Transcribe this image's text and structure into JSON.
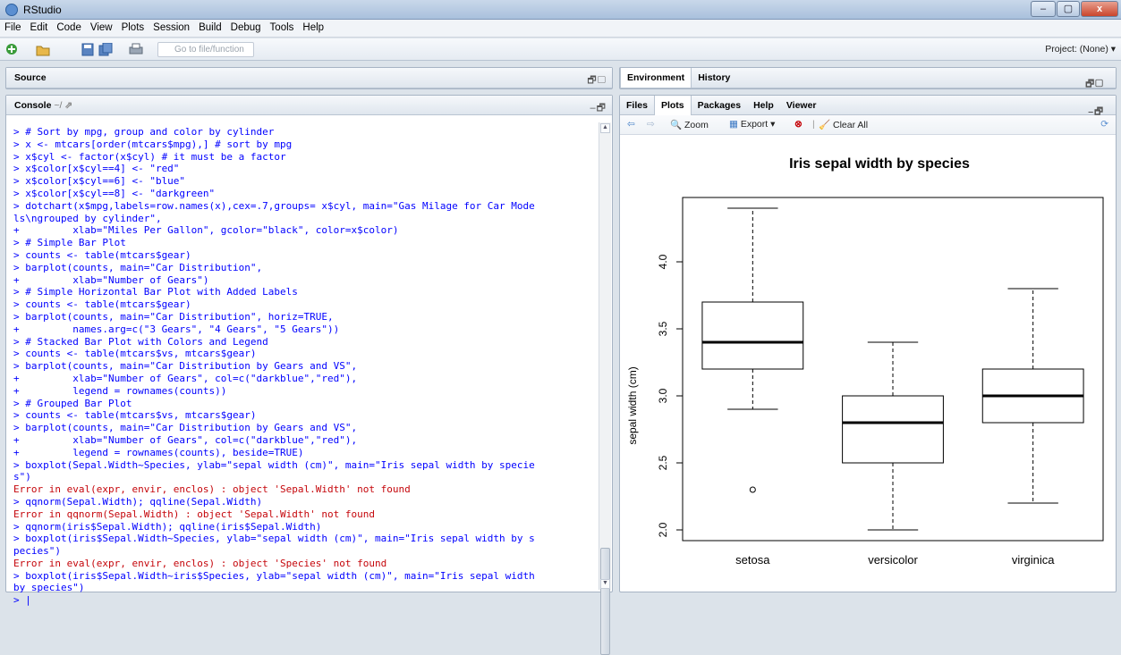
{
  "window": {
    "title": "RStudio",
    "controls": [
      "–",
      "▢",
      "x"
    ]
  },
  "menu": [
    "File",
    "Edit",
    "Code",
    "View",
    "Plots",
    "Session",
    "Build",
    "Debug",
    "Tools",
    "Help"
  ],
  "toolbar": {
    "goto_placeholder": "Go to file/function",
    "project": "Project: (None) ▾"
  },
  "source_pane": {
    "title": "Source"
  },
  "console": {
    "title": "Console",
    "path": "~/",
    "lines": [
      {
        "text": "> # Sort by mpg, group and color by cylinder",
        "type": "cmd"
      },
      {
        "text": "> x <- mtcars[order(mtcars$mpg),] # sort by mpg",
        "type": "cmd"
      },
      {
        "text": "> x$cyl <- factor(x$cyl) # it must be a factor",
        "type": "cmd"
      },
      {
        "text": "> x$color[x$cyl==4] <- \"red\"",
        "type": "cmd"
      },
      {
        "text": "> x$color[x$cyl==6] <- \"blue\"",
        "type": "cmd"
      },
      {
        "text": "> x$color[x$cyl==8] <- \"darkgreen\"",
        "type": "cmd"
      },
      {
        "text": "> dotchart(x$mpg,labels=row.names(x),cex=.7,groups= x$cyl, main=\"Gas Milage for Car Mode",
        "type": "cmd"
      },
      {
        "text": "ls\\ngrouped by cylinder\",",
        "type": "cmd"
      },
      {
        "text": "+         xlab=\"Miles Per Gallon\", gcolor=\"black\", color=x$color)",
        "type": "cmd"
      },
      {
        "text": "> # Simple Bar Plot",
        "type": "cmd"
      },
      {
        "text": "> counts <- table(mtcars$gear)",
        "type": "cmd"
      },
      {
        "text": "> barplot(counts, main=\"Car Distribution\",",
        "type": "cmd"
      },
      {
        "text": "+         xlab=\"Number of Gears\")",
        "type": "cmd"
      },
      {
        "text": "> # Simple Horizontal Bar Plot with Added Labels",
        "type": "cmd"
      },
      {
        "text": "> counts <- table(mtcars$gear)",
        "type": "cmd"
      },
      {
        "text": "> barplot(counts, main=\"Car Distribution\", horiz=TRUE,",
        "type": "cmd"
      },
      {
        "text": "+         names.arg=c(\"3 Gears\", \"4 Gears\", \"5 Gears\"))",
        "type": "cmd"
      },
      {
        "text": "> # Stacked Bar Plot with Colors and Legend",
        "type": "cmd"
      },
      {
        "text": "> counts <- table(mtcars$vs, mtcars$gear)",
        "type": "cmd"
      },
      {
        "text": "> barplot(counts, main=\"Car Distribution by Gears and VS\",",
        "type": "cmd"
      },
      {
        "text": "+         xlab=\"Number of Gears\", col=c(\"darkblue\",\"red\"),",
        "type": "cmd"
      },
      {
        "text": "+         legend = rownames(counts))",
        "type": "cmd"
      },
      {
        "text": "> # Grouped Bar Plot",
        "type": "cmd"
      },
      {
        "text": "> counts <- table(mtcars$vs, mtcars$gear)",
        "type": "cmd"
      },
      {
        "text": "> barplot(counts, main=\"Car Distribution by Gears and VS\",",
        "type": "cmd"
      },
      {
        "text": "+         xlab=\"Number of Gears\", col=c(\"darkblue\",\"red\"),",
        "type": "cmd"
      },
      {
        "text": "+         legend = rownames(counts), beside=TRUE)",
        "type": "cmd"
      },
      {
        "text": "> boxplot(Sepal.Width~Species, ylab=\"sepal width (cm)\", main=\"Iris sepal width by specie",
        "type": "cmd"
      },
      {
        "text": "s\")",
        "type": "cmd"
      },
      {
        "text": "Error in eval(expr, envir, enclos) : object 'Sepal.Width' not found",
        "type": "err"
      },
      {
        "text": "> qqnorm(Sepal.Width); qqline(Sepal.Width)",
        "type": "cmd"
      },
      {
        "text": "Error in qqnorm(Sepal.Width) : object 'Sepal.Width' not found",
        "type": "err"
      },
      {
        "text": "> qqnorm(iris$Sepal.Width); qqline(iris$Sepal.Width)",
        "type": "cmd"
      },
      {
        "text": "> boxplot(iris$Sepal.Width~Species, ylab=\"sepal width (cm)\", main=\"Iris sepal width by s",
        "type": "cmd"
      },
      {
        "text": "pecies\")",
        "type": "cmd"
      },
      {
        "text": "Error in eval(expr, envir, enclos) : object 'Species' not found",
        "type": "err"
      },
      {
        "text": "> boxplot(iris$Sepal.Width~iris$Species, ylab=\"sepal width (cm)\", main=\"Iris sepal width",
        "type": "cmd"
      },
      {
        "text": "by species\")",
        "type": "cmd"
      },
      {
        "text": "> |",
        "type": "cmd"
      }
    ]
  },
  "env_pane": {
    "tabs": [
      "Environment",
      "History"
    ]
  },
  "files_pane": {
    "tabs": [
      "Files",
      "Plots",
      "Packages",
      "Help",
      "Viewer"
    ],
    "active_tab": "Plots",
    "plot_toolbar": {
      "zoom": "Zoom",
      "export": "Export ▾",
      "clear": "Clear All"
    }
  },
  "chart_data": {
    "type": "boxplot",
    "title": "Iris sepal width by species",
    "ylabel": "sepal width (cm)",
    "xlabel": "",
    "categories": [
      "setosa",
      "versicolor",
      "virginica"
    ],
    "yticks": [
      "2.0",
      "2.5",
      "3.0",
      "3.5",
      "4.0"
    ],
    "ylim": [
      2.0,
      4.4
    ],
    "boxes": [
      {
        "lower_whisker": 2.9,
        "q1": 3.2,
        "median": 3.4,
        "q3": 3.7,
        "upper_whisker": 4.4,
        "outliers": [
          2.3
        ]
      },
      {
        "lower_whisker": 2.0,
        "q1": 2.5,
        "median": 2.8,
        "q3": 3.0,
        "upper_whisker": 3.4,
        "outliers": []
      },
      {
        "lower_whisker": 2.2,
        "q1": 2.8,
        "median": 3.0,
        "q3": 3.2,
        "upper_whisker": 3.8,
        "outliers": []
      }
    ],
    "colors": {
      "box": "#ffffff",
      "stroke": "#000000"
    }
  }
}
